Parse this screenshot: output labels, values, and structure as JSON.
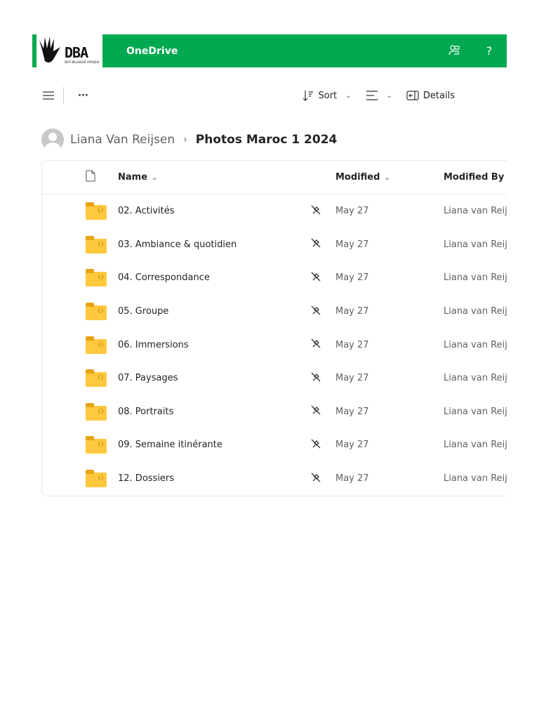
{
  "header": {
    "logo_text": "DBA",
    "logo_subtitle": "DEFI BELGIQUE AFRIQUE",
    "app_name": "OneDrive",
    "icons": [
      "share-people-icon",
      "help-icon"
    ]
  },
  "toolbar": {
    "sort_label": "Sort",
    "details_label": "Details"
  },
  "breadcrumb": {
    "parent": "Liana Van Reijsen",
    "current": "Photos Maroc 1 2024"
  },
  "list": {
    "columns": {
      "name": "Name",
      "modified": "Modified",
      "modified_by": "Modified By"
    },
    "rows": [
      {
        "name": "02. Activités",
        "modified": "May 27",
        "modified_by": "Liana van Reijsen"
      },
      {
        "name": "03. Ambiance & quotidien",
        "modified": "May 27",
        "modified_by": "Liana van Reijsen"
      },
      {
        "name": "04. Correspondance",
        "modified": "May 27",
        "modified_by": "Liana van Reijsen"
      },
      {
        "name": "05. Groupe",
        "modified": "May 27",
        "modified_by": "Liana van Reijsen"
      },
      {
        "name": "06. Immersions",
        "modified": "May 27",
        "modified_by": "Liana van Reijsen"
      },
      {
        "name": "07. Paysages",
        "modified": "May 27",
        "modified_by": "Liana van Reijsen"
      },
      {
        "name": "08. Portraits",
        "modified": "May 27",
        "modified_by": "Liana van Reijsen"
      },
      {
        "name": "09. Semaine itinérante",
        "modified": "May 27",
        "modified_by": "Liana van Reijsen"
      },
      {
        "name": "12. Dossiers",
        "modified": "May 27",
        "modified_by": "Liana van Reijsen"
      }
    ]
  }
}
